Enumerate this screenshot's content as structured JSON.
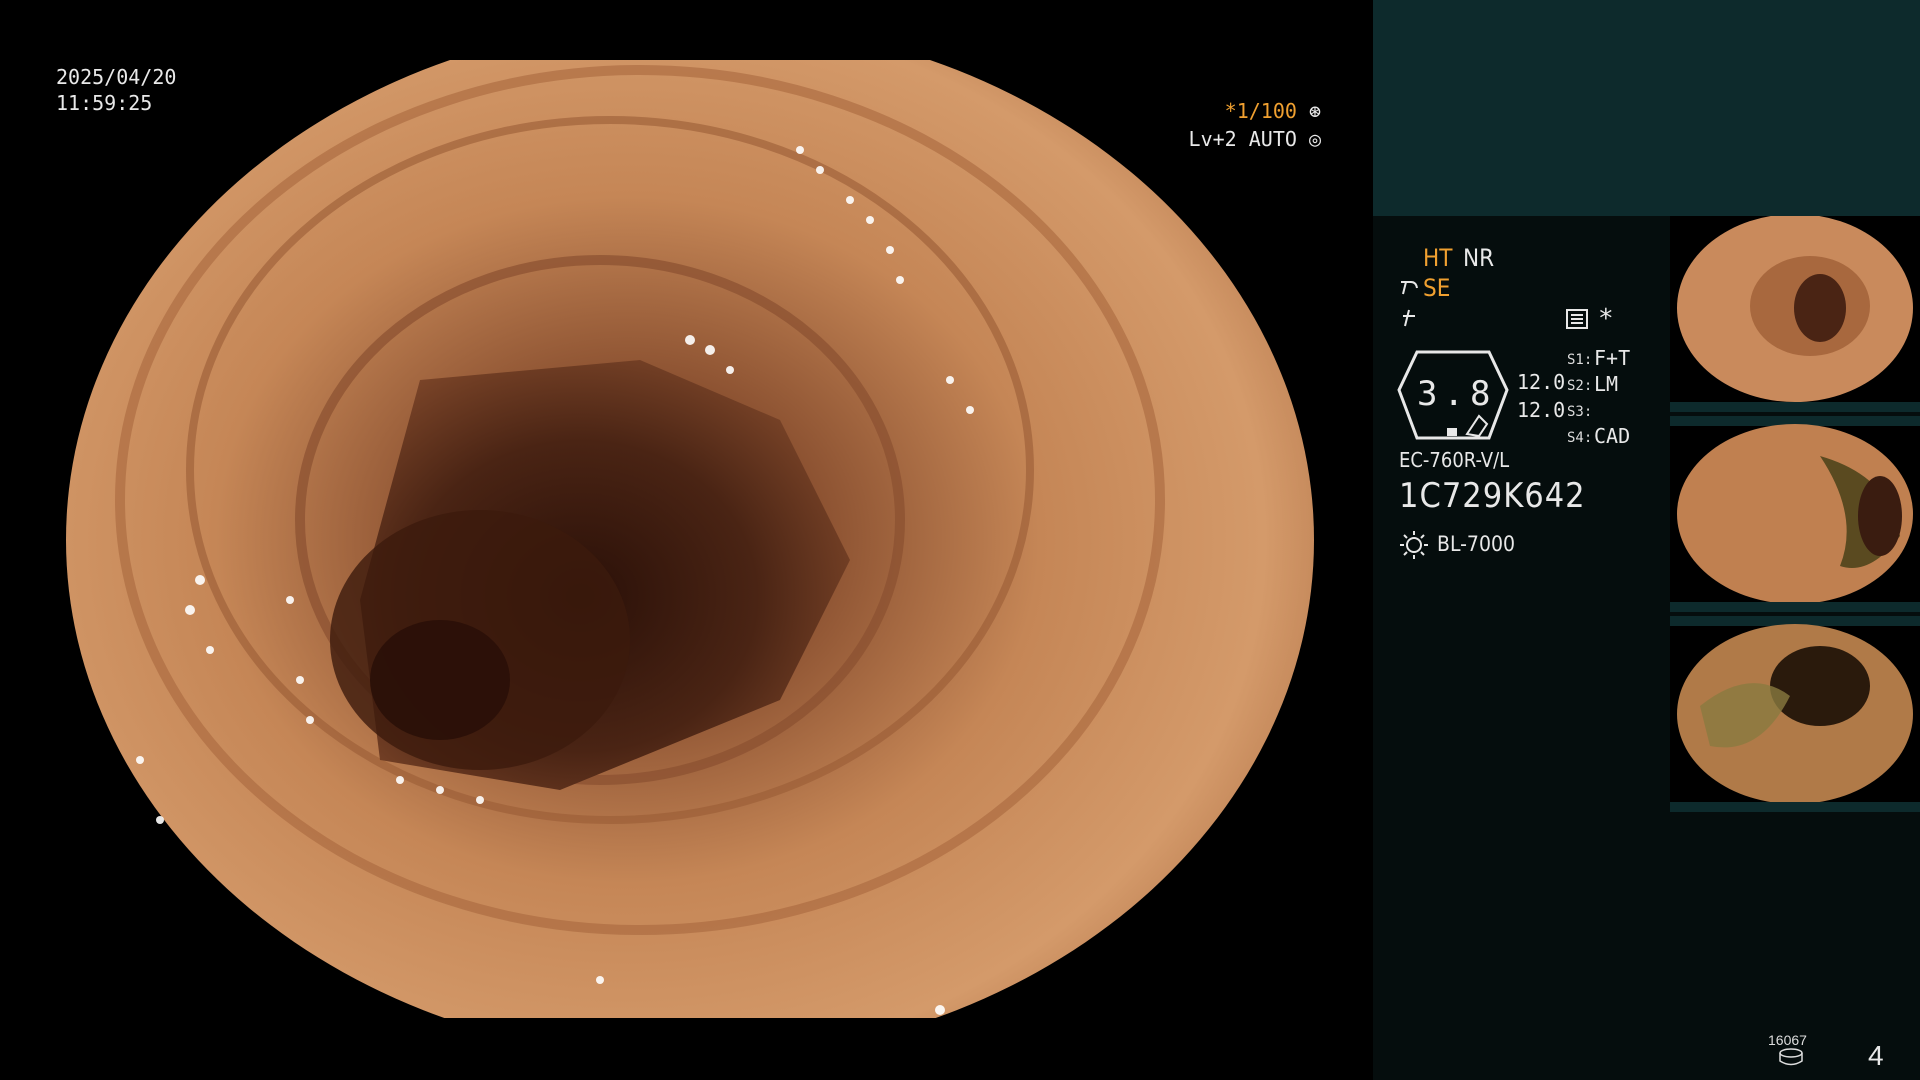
{
  "scope_view": {
    "date": "2025/04/20",
    "time": "11:59:25",
    "shutter": "*1/100",
    "level": "Lv+2 AUTO",
    "colors": {
      "mucosa": "#c98a5c",
      "lumen": "#3a1c10",
      "background": "#000000"
    }
  },
  "panel": {
    "modes": {
      "ht": "HT",
      "nr": "NR",
      "se": "SE"
    },
    "asterisk": "*",
    "zoom": "3.8",
    "values": {
      "top": "12.0",
      "bottom": "12.0"
    },
    "switches": [
      {
        "label": "S1:",
        "value": "F+T"
      },
      {
        "label": "S2:",
        "value": "LM"
      },
      {
        "label": "S3:",
        "value": ""
      },
      {
        "label": "S4:",
        "value": "CAD"
      }
    ],
    "scope_model": "EC-760R-V/L",
    "scope_serial": "1C729K642",
    "light_source": "BL-7000",
    "image_count": "16067",
    "page_number": "4",
    "colors": {
      "accent": "#f0a030",
      "header": "#0d2a2c",
      "body": "#050d0d"
    }
  }
}
